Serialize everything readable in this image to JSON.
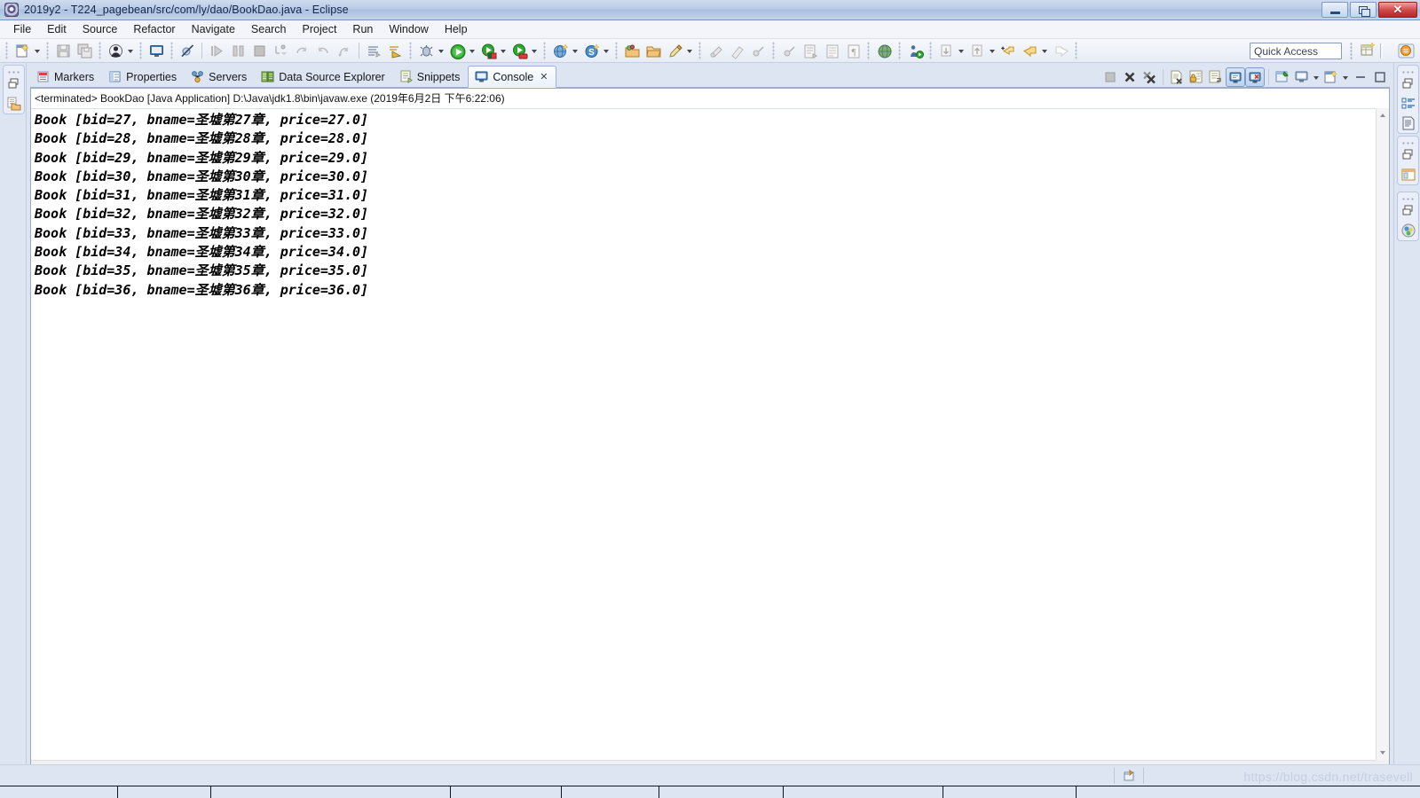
{
  "window": {
    "title": "2019y2 - T224_pagebean/src/com/ly/dao/BookDao.java - Eclipse",
    "app_icon": "eclipse-icon",
    "minimize_label": "",
    "maximize_label": "",
    "close_label": "✕"
  },
  "menubar": {
    "items": [
      {
        "label": "File"
      },
      {
        "label": "Edit"
      },
      {
        "label": "Source"
      },
      {
        "label": "Refactor"
      },
      {
        "label": "Navigate"
      },
      {
        "label": "Search"
      },
      {
        "label": "Project"
      },
      {
        "label": "Run"
      },
      {
        "label": "Window"
      },
      {
        "label": "Help"
      }
    ]
  },
  "toolbar": {
    "quick_access_value": "Quick Access",
    "quick_access_placeholder": "Quick Access",
    "icons": [
      "new-wizard-icon",
      "save-icon",
      "save-all-icon",
      "debug-person-icon",
      "console-icon",
      "skip-breakpoints-icon",
      "resume-icon",
      "suspend-icon",
      "terminate-icon",
      "step-into-icon",
      "step-over-icon",
      "step-return-icon",
      "drop-to-frame-icon",
      "run-last-tool-icon",
      "debug-bug-icon",
      "run-green-icon",
      "run-server-icon",
      "profile-icon",
      "new-web-project-icon",
      "search-s-icon",
      "open-type-icon",
      "open-folder-icon",
      "pencil-icon",
      "marker-icon",
      "eraser-icon",
      "annotation-icon",
      "globe-icon",
      "person-run-icon",
      "next-annotation-icon",
      "previous-annotation-icon",
      "back-icon",
      "forward-icon",
      "last-edit-icon"
    ],
    "perspective_buttons": [
      "open-perspective-icon",
      "java-ee-perspective-icon"
    ]
  },
  "left_fastview": {
    "icons": [
      "restore-icon",
      "package-explorer-icon"
    ]
  },
  "right_fastview": {
    "groups": [
      {
        "icons": [
          "restore-icon",
          "outline-icon",
          "document-icon"
        ]
      },
      {
        "icons": [
          "restore-icon",
          "panel-layout-icon"
        ]
      },
      {
        "icons": [
          "restore-icon",
          "servers-status-icon"
        ]
      }
    ]
  },
  "console_view": {
    "tabs": [
      {
        "label": "Markers",
        "icon": "markers-icon",
        "active": false,
        "closable": false
      },
      {
        "label": "Properties",
        "icon": "properties-icon",
        "active": false,
        "closable": false
      },
      {
        "label": "Servers",
        "icon": "servers-icon",
        "active": false,
        "closable": false
      },
      {
        "label": "Data Source Explorer",
        "icon": "data-source-explorer-icon",
        "active": false,
        "closable": false
      },
      {
        "label": "Snippets",
        "icon": "snippets-icon",
        "active": false,
        "closable": false
      },
      {
        "label": "Console",
        "icon": "console-tab-icon",
        "active": true,
        "closable": true,
        "close_glyph": "✕"
      }
    ],
    "view_tools": [
      {
        "name": "terminate-icon",
        "toggled": false
      },
      {
        "name": "remove-launch-icon",
        "toggled": false
      },
      {
        "name": "remove-all-launches-icon",
        "toggled": false
      },
      {
        "name": "clear-console-icon",
        "toggled": false
      },
      {
        "name": "scroll-lock-icon",
        "toggled": false
      },
      {
        "name": "word-wrap-icon",
        "toggled": false
      },
      {
        "name": "show-console-on-output-icon",
        "toggled": true
      },
      {
        "name": "show-console-on-error-icon",
        "toggled": true
      },
      {
        "name": "pin-console-icon",
        "toggled": false
      },
      {
        "name": "display-selected-console-icon",
        "toggled": false
      },
      {
        "name": "open-console-icon",
        "toggled": false
      }
    ],
    "view_menu_icons": [
      "view-minimize-icon",
      "view-maximize-icon"
    ],
    "launch_line": "<terminated> BookDao [Java Application] D:\\Java\\jdk1.8\\bin\\javaw.exe (2019年6月2日 下午6:22:06)",
    "output_lines": [
      "Book [bid=27, bname=圣墟第27章, price=27.0]",
      "Book [bid=28, bname=圣墟第28章, price=28.0]",
      "Book [bid=29, bname=圣墟第29章, price=29.0]",
      "Book [bid=30, bname=圣墟第30章, price=30.0]",
      "Book [bid=31, bname=圣墟第31章, price=31.0]",
      "Book [bid=32, bname=圣墟第32章, price=32.0]",
      "Book [bid=33, bname=圣墟第33章, price=33.0]",
      "Book [bid=34, bname=圣墟第34章, price=34.0]",
      "Book [bid=35, bname=圣墟第35章, price=35.0]",
      "Book [bid=36, bname=圣墟第36章, price=36.0]"
    ]
  },
  "statusbar": {
    "icon": "smart-insert-icon",
    "text": ""
  },
  "watermark": {
    "text": "https://blog.csdn.net/trasevell"
  },
  "colors": {
    "titlebar_start": "#cfdcef",
    "titlebar_end": "#c3d4ec",
    "chrome": "#dde4f2",
    "tab_active": "#fdfeff",
    "console_bg": "#ffffff",
    "console_text": "#000000",
    "close_button": "#d04545"
  }
}
